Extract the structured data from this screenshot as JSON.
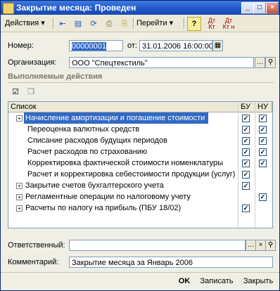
{
  "window": {
    "title": "Закрытие месяца: Проведен"
  },
  "toolbar": {
    "actions_label": "Действия",
    "goto_label": "Перейти",
    "help_label": "?",
    "dt_kt_label": "Дт Кт",
    "dt_kt_n_label": "Дт Кт н"
  },
  "form": {
    "number_label": "Номер:",
    "number_value": "00000001",
    "date_label": "от:",
    "date_value": "31.01.2006 16:00:00",
    "org_label": "Организация:",
    "org_value": "ООО \"Спецтекстиль\"",
    "section_title": "Выполняемые действия",
    "responsible_label": "Ответственный:",
    "responsible_value": "",
    "comment_label": "Комментарий:",
    "comment_value": "Закрытие месяца за Январь 2006"
  },
  "table": {
    "columns": [
      "Список",
      "БУ",
      "НУ"
    ],
    "rows": [
      {
        "label": "Начисление амортизации и погашение стоимости",
        "expand": true,
        "bu": true,
        "nu": true
      },
      {
        "label": "Переоценка валютных средств",
        "expand": false,
        "bu": true,
        "nu": true
      },
      {
        "label": "Списание расходов будущих периодов",
        "expand": false,
        "bu": true,
        "nu": true
      },
      {
        "label": "Расчет расходов по страхованию",
        "expand": false,
        "bu": true,
        "nu": true
      },
      {
        "label": "Корректировка фактической стоимости номенклатуры",
        "expand": false,
        "bu": true,
        "nu": true
      },
      {
        "label": "Расчет и корректировка себестоимости продукции (услуг)",
        "expand": false,
        "bu": true,
        "nu": false
      },
      {
        "label": "Закрытие счетов бухгалтерского учета",
        "expand": true,
        "bu": true,
        "nu": false
      },
      {
        "label": "Регламентные операции по налоговому учету",
        "expand": true,
        "bu": false,
        "nu": true
      },
      {
        "label": "Расчеты по налогу на прибыль (ПБУ 18/02)",
        "expand": true,
        "bu": true,
        "nu": false
      }
    ]
  },
  "buttons": {
    "ok": "OK",
    "save": "Записать",
    "close": "Закрыть"
  },
  "colors": {
    "title_bar": "#1f55c8",
    "selection": "#316ac5"
  }
}
